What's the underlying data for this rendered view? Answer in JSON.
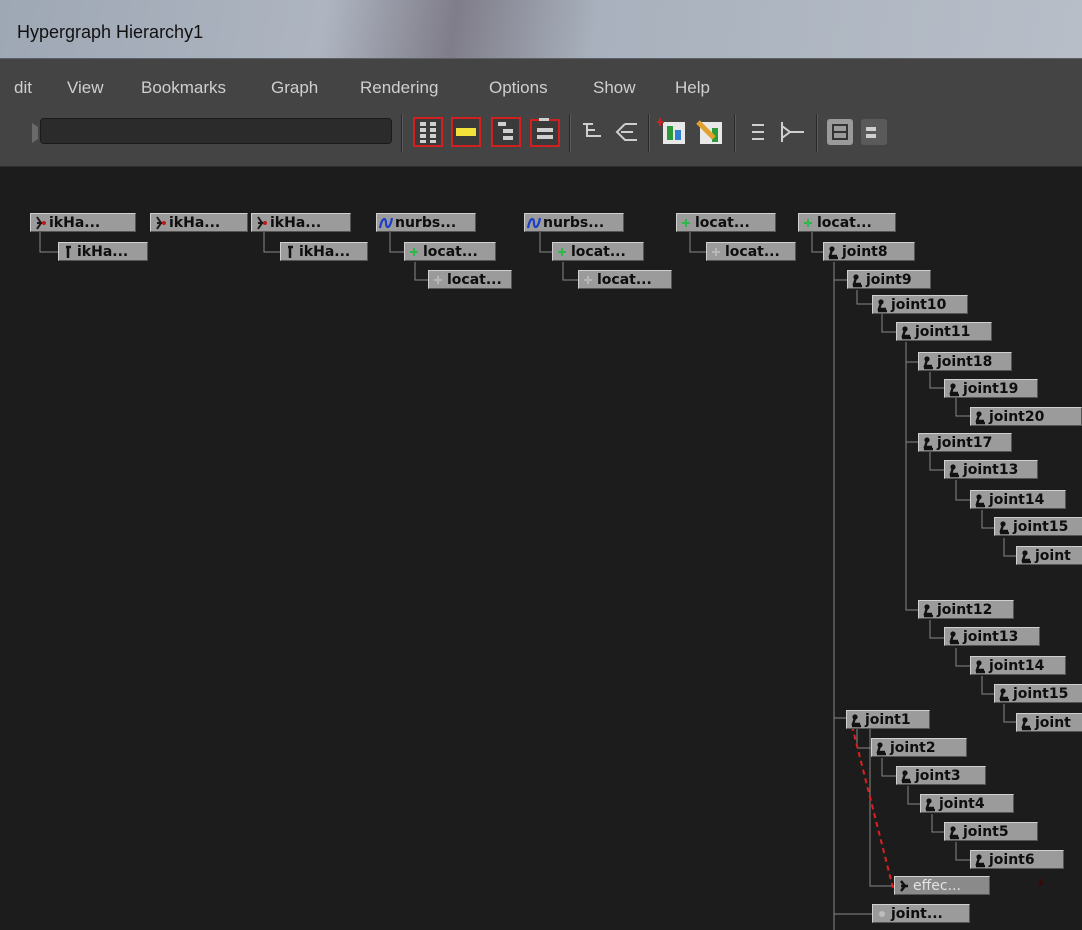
{
  "window": {
    "title": "Hypergraph Hierarchy1"
  },
  "menu": [
    "dit",
    "View",
    "Bookmarks",
    "Graph",
    "Rendering",
    "Options",
    "Show",
    "Help"
  ],
  "toolbar": {
    "filter_value": "",
    "buttons": [
      "scene-hierarchy-icon",
      "selection-hierarchy-icon",
      "expand-hierarchy-icon",
      "input-output-icon",
      "tree-layout-icon",
      "reverse-tree-icon",
      "add-bookmark-icon",
      "edit-bookmark-icon",
      "list-view-icon",
      "graph-view-icon",
      "toggle-view-icon",
      "collapse-icon"
    ]
  },
  "nodes": [
    {
      "id": "n1",
      "label": "ikHa...",
      "icon": "ik-handle-icon"
    },
    {
      "id": "n2",
      "label": "ikHa...",
      "icon": "ik-effector-icon"
    },
    {
      "id": "n3",
      "label": "ikHa...",
      "icon": "ik-handle-icon"
    },
    {
      "id": "n4",
      "label": "ikHa...",
      "icon": "ik-handle-icon"
    },
    {
      "id": "n5",
      "label": "ikHa...",
      "icon": "ik-effector-icon"
    },
    {
      "id": "n6",
      "label": "nurbs...",
      "icon": "nurbs-curve-icon"
    },
    {
      "id": "n7",
      "label": "locat...",
      "icon": "locator-icon"
    },
    {
      "id": "n8",
      "label": "locat...",
      "icon": "locator-shape-icon"
    },
    {
      "id": "n9",
      "label": "nurbs...",
      "icon": "nurbs-curve-icon"
    },
    {
      "id": "n10",
      "label": "locat...",
      "icon": "locator-icon"
    },
    {
      "id": "n11",
      "label": "locat...",
      "icon": "locator-shape-icon"
    },
    {
      "id": "n12",
      "label": "locat...",
      "icon": "locator-icon"
    },
    {
      "id": "n13",
      "label": "locat...",
      "icon": "locator-shape-icon"
    },
    {
      "id": "n14",
      "label": "locat...",
      "icon": "locator-icon"
    },
    {
      "id": "n15",
      "label": "joint8",
      "icon": "joint-icon"
    },
    {
      "id": "n16",
      "label": "joint9",
      "icon": "joint-icon"
    },
    {
      "id": "n17",
      "label": "joint10",
      "icon": "joint-icon"
    },
    {
      "id": "n18",
      "label": "joint11",
      "icon": "joint-icon"
    },
    {
      "id": "n19",
      "label": "joint18",
      "icon": "joint-icon"
    },
    {
      "id": "n20",
      "label": "joint19",
      "icon": "joint-icon"
    },
    {
      "id": "n21",
      "label": "joint20",
      "icon": "joint-icon"
    },
    {
      "id": "n22",
      "label": "joint17",
      "icon": "joint-icon"
    },
    {
      "id": "n23",
      "label": "joint13",
      "icon": "joint-icon"
    },
    {
      "id": "n24",
      "label": "joint14",
      "icon": "joint-icon"
    },
    {
      "id": "n25",
      "label": "joint15",
      "icon": "joint-icon"
    },
    {
      "id": "n26",
      "label": "joint",
      "icon": "joint-icon"
    },
    {
      "id": "n27",
      "label": "joint12",
      "icon": "joint-icon"
    },
    {
      "id": "n28",
      "label": "joint13",
      "icon": "joint-icon"
    },
    {
      "id": "n29",
      "label": "joint14",
      "icon": "joint-icon"
    },
    {
      "id": "n30",
      "label": "joint15",
      "icon": "joint-icon"
    },
    {
      "id": "n31",
      "label": "joint",
      "icon": "joint-icon"
    },
    {
      "id": "n32",
      "label": "joint1",
      "icon": "joint-icon"
    },
    {
      "id": "n33",
      "label": "joint2",
      "icon": "joint-icon"
    },
    {
      "id": "n34",
      "label": "joint3",
      "icon": "joint-icon"
    },
    {
      "id": "n35",
      "label": "joint4",
      "icon": "joint-icon"
    },
    {
      "id": "n36",
      "label": "joint5",
      "icon": "joint-icon"
    },
    {
      "id": "n37",
      "label": "joint6",
      "icon": "joint-icon"
    },
    {
      "id": "n38",
      "label": "effec...",
      "icon": "effector-icon",
      "dim": true
    },
    {
      "id": "n39",
      "label": "joint...",
      "icon": "joint-shape-icon"
    }
  ],
  "colors": {
    "ik_link": "#e02020",
    "wire": "#8a8a8a",
    "node_bg": "#9b9b9b"
  }
}
